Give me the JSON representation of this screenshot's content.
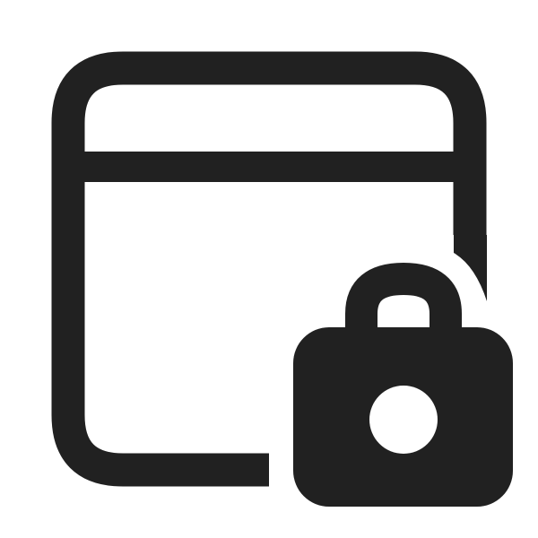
{
  "icon": {
    "name": "window-lock-icon",
    "color": "#212121",
    "background": "#ffffff",
    "parts": [
      "window-frame",
      "window-title-bar-divider",
      "padlock"
    ]
  }
}
